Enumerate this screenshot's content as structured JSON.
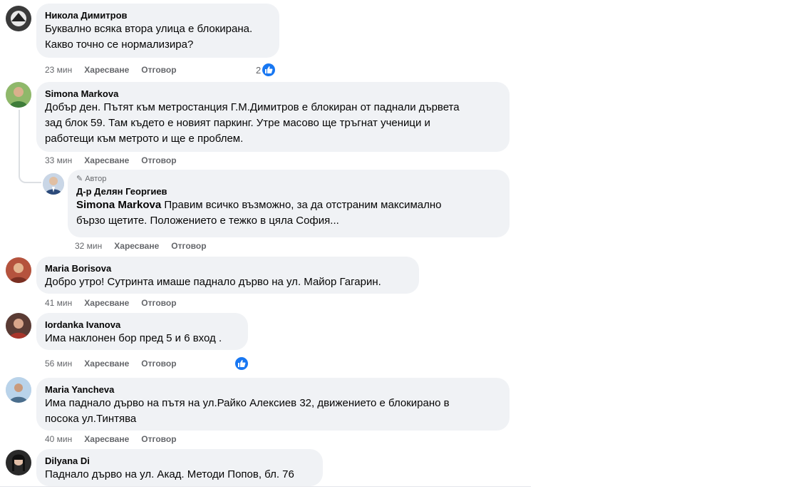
{
  "comments": [
    {
      "name": "Никола Димитров",
      "lines": [
        "Буквално всяка втора улица е блокирана.",
        "Какво точно се нормализира?"
      ],
      "time": "23 мин",
      "like_label": "Харесване",
      "reply_label": "Отговор",
      "reactions": "2"
    },
    {
      "name": "Simona Markova",
      "lines": [
        "Добър ден. Пътят към метростанция Г.М.Димитров е блокиран от паднали дървета",
        "зад блок 59. Там където е новият паркинг. Утре масово ще тръгнат ученици и",
        "работещи към метрото и ще е проблем."
      ],
      "time": "33 мин",
      "like_label": "Харесване",
      "reply_label": "Отговор"
    },
    {
      "author_tag": "Автор",
      "name": "Д-р Делян Георгиев",
      "mention": "Simona Markova",
      "lines": [
        " Правим всичко възможно, за да отстраним максимално",
        "бързо щетите. Положението е тежко в цяла София..."
      ],
      "time": "32 мин",
      "like_label": "Харесване",
      "reply_label": "Отговор"
    },
    {
      "name": "Maria Borisova",
      "lines": [
        "Добро утро! Сутринта имаше паднало дърво на ул. Майор Гагарин."
      ],
      "time": "41 мин",
      "like_label": "Харесване",
      "reply_label": "Отговор"
    },
    {
      "name": "Iordanka Ivanova",
      "lines": [
        "Има наклонен бор пред 5 и 6 вход ."
      ],
      "time": "56 мин",
      "like_label": "Харесване",
      "reply_label": "Отговор"
    },
    {
      "name": "Maria Yancheva",
      "lines": [
        "Има паднало дърво на пътя на ул.Райко Алексиев 32, движението е блокирано в",
        "посока ул.Тинтява"
      ],
      "time": "40 мин",
      "like_label": "Харесване",
      "reply_label": "Отговор"
    },
    {
      "name": "Dilyana Di",
      "lines": [
        "Паднало дърво на ул. Акад. Методи Попов, бл. 76"
      ]
    }
  ],
  "colors": {
    "bubble": "#f0f2f5",
    "meta": "#65676b",
    "like_blue": "#1877f2"
  },
  "icons": {
    "like": "thumbs-up-icon",
    "author": "pencil-icon"
  }
}
